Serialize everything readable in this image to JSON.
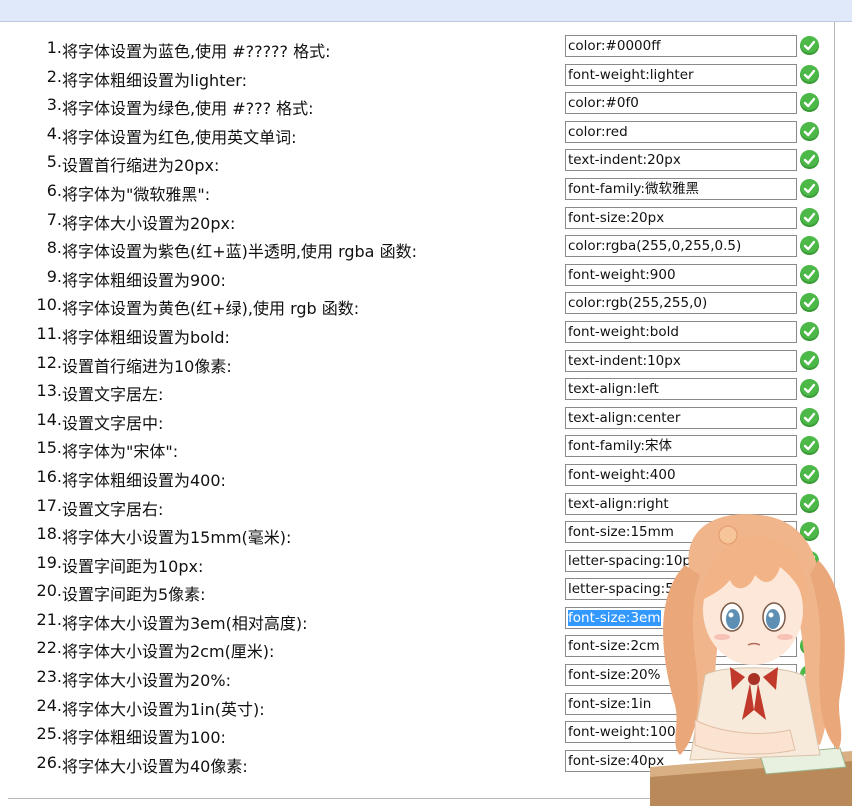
{
  "exercises": [
    {
      "num": "1.",
      "question": "将字体设置为蓝色,使用 #????? 格式:",
      "answer": "color:#0000ff",
      "correct": true
    },
    {
      "num": "2.",
      "question": "将字体粗细设置为lighter:",
      "answer": "font-weight:lighter",
      "correct": true
    },
    {
      "num": "3.",
      "question": "将字体设置为绿色,使用 #??? 格式:",
      "answer": "color:#0f0",
      "correct": true
    },
    {
      "num": "4.",
      "question": "将字体设置为红色,使用英文单词:",
      "answer": "color:red",
      "correct": true
    },
    {
      "num": "5.",
      "question": "设置首行缩进为20px:",
      "answer": "text-indent:20px",
      "correct": true
    },
    {
      "num": "6.",
      "question": "将字体为\"微软雅黑\":",
      "answer": "font-family:微软雅黑",
      "correct": true
    },
    {
      "num": "7.",
      "question": "将字体大小设置为20px:",
      "answer": "font-size:20px",
      "correct": true
    },
    {
      "num": "8.",
      "question": "将字体设置为紫色(红+蓝)半透明,使用 rgba 函数:",
      "answer": "color:rgba(255,0,255,0.5)",
      "correct": true
    },
    {
      "num": "9.",
      "question": "将字体粗细设置为900:",
      "answer": "font-weight:900",
      "correct": true
    },
    {
      "num": "10.",
      "question": "将字体设置为黄色(红+绿),使用 rgb 函数:",
      "answer": "color:rgb(255,255,0)",
      "correct": true
    },
    {
      "num": "11.",
      "question": "将字体粗细设置为bold:",
      "answer": "font-weight:bold",
      "correct": true
    },
    {
      "num": "12.",
      "question": "设置首行缩进为10像素:",
      "answer": "text-indent:10px",
      "correct": true
    },
    {
      "num": "13.",
      "question": "设置文字居左:",
      "answer": "text-align:left",
      "correct": true
    },
    {
      "num": "14.",
      "question": "设置文字居中:",
      "answer": "text-align:center",
      "correct": true
    },
    {
      "num": "15.",
      "question": "将字体为\"宋体\":",
      "answer": "font-family:宋体",
      "correct": true
    },
    {
      "num": "16.",
      "question": "将字体粗细设置为400:",
      "answer": "font-weight:400",
      "correct": true
    },
    {
      "num": "17.",
      "question": "设置文字居右:",
      "answer": "text-align:right",
      "correct": true
    },
    {
      "num": "18.",
      "question": "将字体大小设置为15mm(毫米):",
      "answer": "font-size:15mm",
      "correct": true
    },
    {
      "num": "19.",
      "question": "设置字间距为10px:",
      "answer": "letter-spacing:10px",
      "correct": true
    },
    {
      "num": "20.",
      "question": "设置字间距为5像素:",
      "answer": "letter-spacing:5px",
      "correct": true
    },
    {
      "num": "21.",
      "question": "将字体大小设置为3em(相对高度):",
      "answer": "font-size:3em",
      "correct": true,
      "selected": true
    },
    {
      "num": "22.",
      "question": "将字体大小设置为2cm(厘米):",
      "answer": "font-size:2cm",
      "correct": true
    },
    {
      "num": "23.",
      "question": "将字体大小设置为20%:",
      "answer": "font-size:20%",
      "correct": true
    },
    {
      "num": "24.",
      "question": "将字体大小设置为1in(英寸):",
      "answer": "font-size:1in",
      "correct": true
    },
    {
      "num": "25.",
      "question": "将字体粗细设置为100:",
      "answer": "font-weight:100",
      "correct": true
    },
    {
      "num": "26.",
      "question": "将字体大小设置为40像素:",
      "answer": "font-size:40px",
      "correct": true
    }
  ],
  "icons": {
    "check": "check-circle-icon",
    "mascot": "anime-girl-mascot"
  },
  "colors": {
    "check_green": "#4cb848",
    "selection": "#3399ff",
    "topbar": "#dfe9f9"
  }
}
